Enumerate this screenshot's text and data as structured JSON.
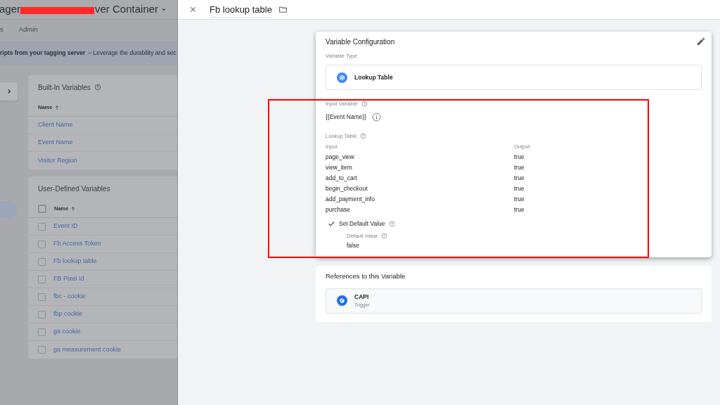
{
  "background_page": {
    "header": {
      "title_start": "ager",
      "title_end": "ver Container"
    },
    "tabs": [
      "s",
      "Admin"
    ],
    "banner": {
      "bold": "ripts from your tagging server",
      "text": "– Leverage the durability and sec"
    },
    "built_in_variables": {
      "title": "Built-In Variables",
      "column": "Name",
      "rows": [
        "Client Name",
        "Event Name",
        "Visitor Region"
      ]
    },
    "user_defined_variables": {
      "title": "User-Defined Variables",
      "column": "Name",
      "checked": false,
      "rows": [
        {
          "name": "Event ID",
          "checked": false
        },
        {
          "name": "Fb Access Token",
          "checked": false
        },
        {
          "name": "Fb lookup table",
          "checked": false
        },
        {
          "name": "FB Pixel Id",
          "checked": false
        },
        {
          "name": "fbc - cookie",
          "checked": false
        },
        {
          "name": "fbp cookie",
          "checked": false
        },
        {
          "name": "ga cookie",
          "checked": false
        },
        {
          "name": "ga measurement cookie",
          "checked": false
        }
      ]
    }
  },
  "editor": {
    "title": "Fb lookup table",
    "variable_configuration": {
      "title": "Variable Configuration",
      "type_label": "Variable Type",
      "type": "Lookup Table",
      "input_variable_label": "Input Variable",
      "input_variable": "{{Event Name}}",
      "lookup_table_label": "Lookup Table",
      "columns": [
        "Input",
        "Output"
      ],
      "rows": [
        {
          "input": "page_view",
          "output": "true"
        },
        {
          "input": "view_item",
          "output": "true"
        },
        {
          "input": "add_to_cart",
          "output": "true"
        },
        {
          "input": "begin_checkout",
          "output": "true"
        },
        {
          "input": "add_payment_info",
          "output": "true"
        },
        {
          "input": "purchase",
          "output": "true"
        }
      ],
      "set_default": {
        "label": "Set Default Value",
        "checked": true,
        "value_label": "Default Value",
        "value": "false"
      }
    },
    "references": {
      "title": "References to this Variable",
      "items": [
        {
          "name": "CAPI",
          "type": "Trigger"
        }
      ]
    }
  }
}
